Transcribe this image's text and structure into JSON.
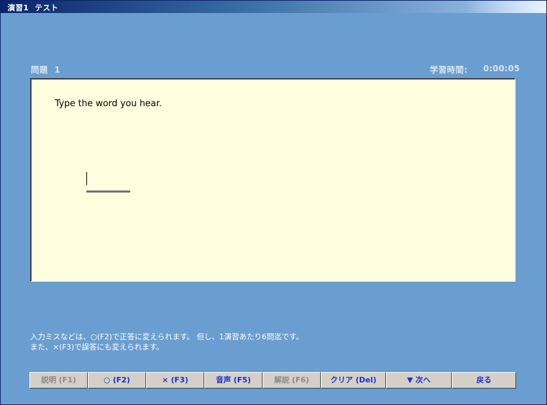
{
  "window": {
    "title": "演習1  テスト"
  },
  "header": {
    "question_label": "問題  1",
    "time_label": "学習時間:",
    "time_value": "0:00:05"
  },
  "panel": {
    "prompt": "Type the word you hear.",
    "answer_value": ""
  },
  "notes": {
    "line1": "入力ミスなどは、○(F2)で正答に変えられます。 但し、1演習あたり6問迄です。",
    "line2": "また、×(F3)で誤答にも変えられます。"
  },
  "buttons": {
    "explain": "説明 (F1)",
    "correct": "○ (F2)",
    "wrong": "× (F3)",
    "audio": "音声 (F5)",
    "commentary": "解説 (F6)",
    "clear": "クリア (Del)",
    "next": "▼ 次へ",
    "back": "戻る"
  },
  "colors": {
    "background": "#6a9ed0",
    "panel": "#ffffe0",
    "button_text": "#1a2fd8",
    "disabled_text": "#8a8a8a"
  }
}
